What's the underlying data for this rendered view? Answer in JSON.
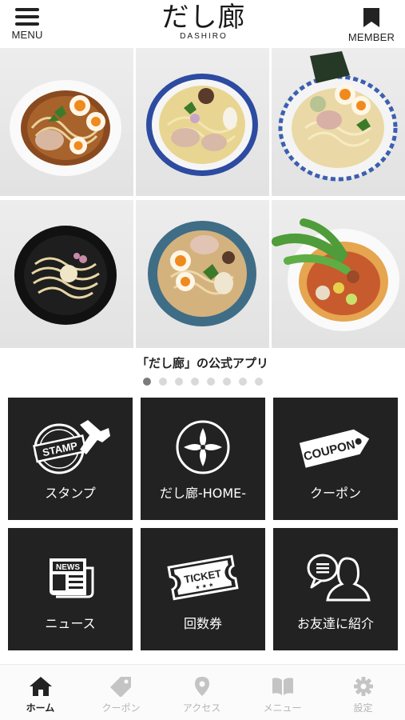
{
  "header": {
    "menu_label": "MENU",
    "logo_text": "だし廊",
    "logo_subtext": "DASHIRO",
    "member_label": "MEMBER"
  },
  "carousel": {
    "caption": "「だし廊」の公式アプリ",
    "dot_count": 8,
    "active_index": 0
  },
  "tiles": [
    {
      "label": "スタンプ",
      "icon": "stamp-icon",
      "icon_text": "STAMP"
    },
    {
      "label": "だし廊-HOME-",
      "icon": "home-emblem-icon"
    },
    {
      "label": "クーポン",
      "icon": "coupon-icon",
      "icon_text": "COUPON"
    },
    {
      "label": "ニュース",
      "icon": "news-icon",
      "icon_text": "NEWS"
    },
    {
      "label": "回数券",
      "icon": "ticket-icon",
      "icon_text": "TICKET"
    },
    {
      "label": "お友達に紹介",
      "icon": "refer-friend-icon"
    }
  ],
  "tabbar": {
    "items": [
      {
        "label": "ホーム",
        "icon": "home-icon",
        "active": true
      },
      {
        "label": "クーポン",
        "icon": "tag-icon",
        "active": false
      },
      {
        "label": "アクセス",
        "icon": "map-pin-icon",
        "active": false
      },
      {
        "label": "メニュー",
        "icon": "book-icon",
        "active": false
      },
      {
        "label": "設定",
        "icon": "gear-icon",
        "active": false
      }
    ]
  },
  "colors": {
    "tile_background": "#222222",
    "active_text": "#222222",
    "inactive_text": "#b5b5b5",
    "dot_active": "#7b7b7b",
    "dot_inactive": "#d9d9d9"
  }
}
